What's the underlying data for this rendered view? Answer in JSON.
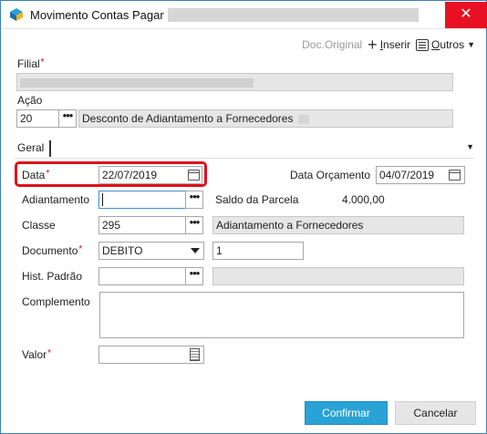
{
  "window": {
    "title": "Movimento Contas Pagar",
    "close_glyph": "✕"
  },
  "toolbar": {
    "doc_original": "Doc.Original",
    "inserir": "Inserir",
    "outros": "Outros"
  },
  "filial": {
    "label": "Filial",
    "required": "*"
  },
  "acao": {
    "label": "Ação",
    "code": "20",
    "description": "Desconto de Adiantamento a Fornecedores"
  },
  "tabs": {
    "geral": "Geral"
  },
  "form": {
    "data": {
      "label": "Data",
      "required": "*",
      "value": "22/07/2019"
    },
    "data_orcamento": {
      "label": "Data Orçamento",
      "value": "04/07/2019"
    },
    "adiantamento": {
      "label": "Adiantamento",
      "value": ""
    },
    "saldo_parcela": {
      "label": "Saldo da Parcela",
      "value": "4.000,00"
    },
    "classe": {
      "label": "Classe",
      "code": "295",
      "description": "Adiantamento a Fornecedores"
    },
    "documento": {
      "label": "Documento",
      "required": "*",
      "value": "DEBITO",
      "number": "1"
    },
    "hist_padrao": {
      "label": "Hist. Padrão",
      "value": ""
    },
    "complemento": {
      "label": "Complemento",
      "value": ""
    },
    "valor": {
      "label": "Valor",
      "required": "*",
      "value": ""
    }
  },
  "buttons": {
    "confirmar": "Confirmar",
    "cancelar": "Cancelar"
  },
  "ellipsis": "•••",
  "colors": {
    "primary": "#29a3d6",
    "highlight": "#e0101b",
    "close": "#e81123"
  }
}
